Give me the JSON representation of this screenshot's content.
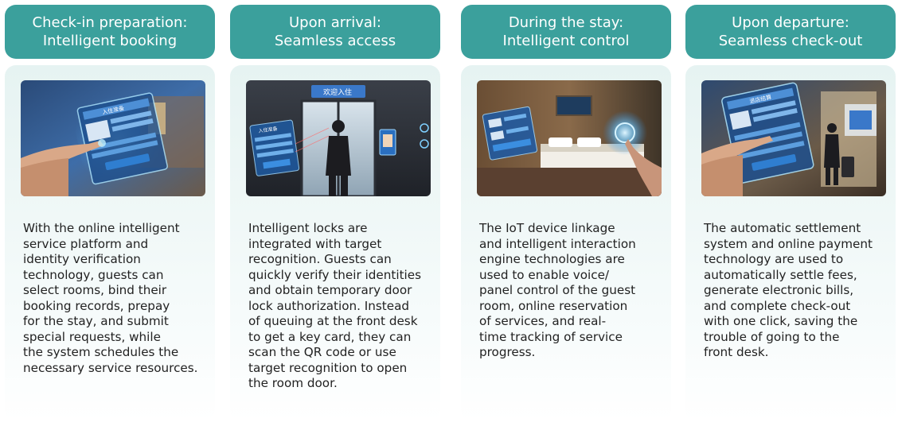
{
  "stages": [
    {
      "title_line1": "Check-in preparation:",
      "title_line2": "Intelligent booking",
      "image_icon": "booking-tablet-image",
      "image_text": [
        "入住准备"
      ],
      "body_lines": [
        "With the online intelligent",
        "service platform and",
        "identity verification",
        "technology, guests can",
        "select rooms, bind their",
        "booking records, prepay",
        "for the stay, and submit",
        "special requests, while",
        "the system schedules the",
        "necessary service resources."
      ]
    },
    {
      "title_line1": "Upon arrival:",
      "title_line2": "Seamless access",
      "image_icon": "hotel-entrance-image",
      "image_text": [
        "欢迎入住",
        "入住准备"
      ],
      "body_lines": [
        "Intelligent locks are",
        "integrated with target",
        "recognition. Guests can",
        "quickly verify their identities",
        "and obtain temporary door",
        "lock authorization. Instead",
        "of queuing at the front desk",
        "to get a key card, they can",
        "scan the QR code or use",
        "target recognition to open",
        "the room door."
      ]
    },
    {
      "title_line1": "During the stay:",
      "title_line2": "Intelligent control",
      "image_icon": "guest-room-control-image",
      "image_text": [],
      "body_lines": [
        "The IoT device linkage",
        "and intelligent interaction",
        "engine technologies are",
        "used to enable voice/",
        "panel control of the guest",
        "room, online reservation",
        "of services, and real-",
        "time tracking of service",
        "progress."
      ]
    },
    {
      "title_line1": "Upon departure:",
      "title_line2": "Seamless check-out",
      "image_icon": "checkout-tablet-image",
      "image_text": [
        "退店结算"
      ],
      "body_lines": [
        "The automatic settlement",
        "system and online payment",
        "technology are used to",
        "automatically settle fees,",
        "generate electronic bills,",
        "and complete check-out",
        "with one click, saving the",
        "trouble of going to the",
        "front desk."
      ]
    }
  ],
  "colors": {
    "header_bg": "#3ba09c",
    "header_text": "#ffffff",
    "card_bg_top": "#e6f3f2",
    "body_text": "#222222"
  }
}
